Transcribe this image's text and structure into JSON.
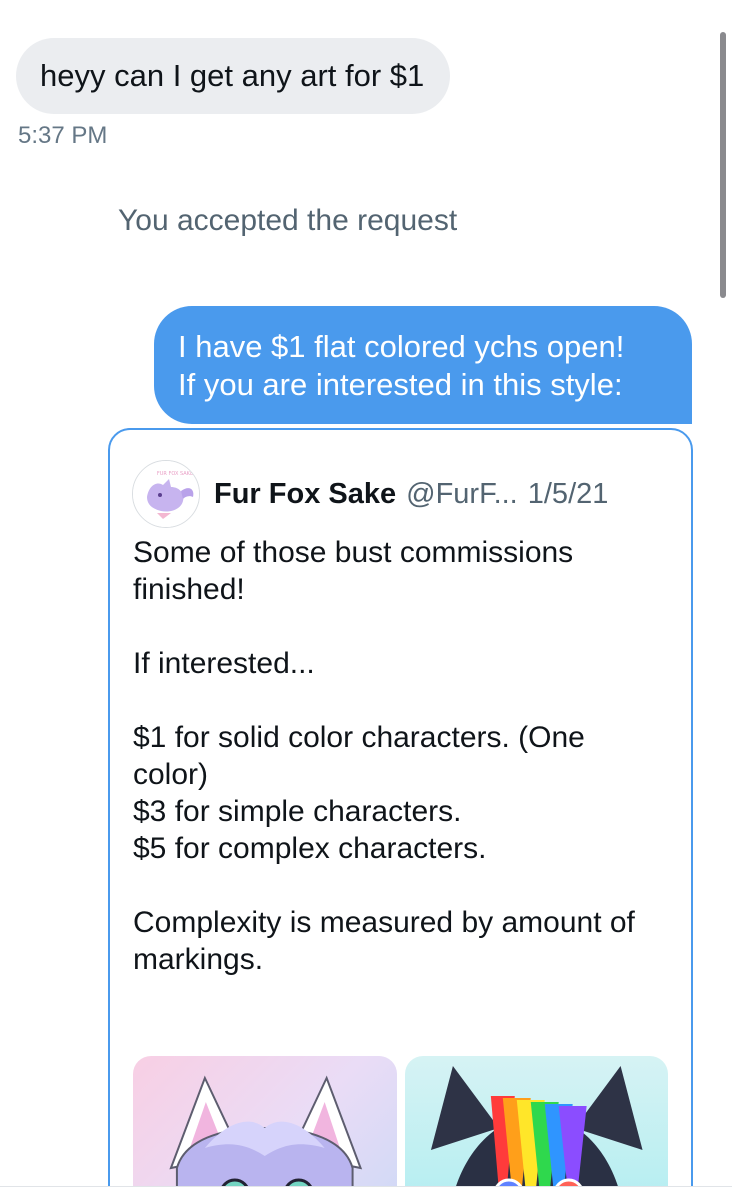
{
  "messages": {
    "incoming": {
      "text": "heyy can I get any art for $1",
      "time": "5:37 PM"
    },
    "system_note": "You accepted the request",
    "outgoing": {
      "line1": "I have $1 flat colored ychs open!",
      "line2": "If you are interested in this style:"
    }
  },
  "quoted_tweet": {
    "author_name": "Fur Fox Sake",
    "handle": "@FurF...",
    "date": "1/5/21",
    "avatar_text": "FUR FOX SAKE",
    "paragraphs": [
      "Some of those bust commissions finished!",
      "If interested...",
      "$1 for solid color characters. (One color)",
      "$3 for simple characters.",
      "$5 for complex characters.",
      "Complexity is measured by amount of markings."
    ],
    "media": [
      {
        "label": "left-fox-bust"
      },
      {
        "label": "right-rainbow-bust"
      }
    ]
  },
  "colors": {
    "incoming_bubble": "#ebedf0",
    "outgoing_bubble": "#4a9aed",
    "accent": "#4a9aed",
    "secondary_text": "#536471"
  },
  "icons": {
    "avatar": "fox-avatar-icon"
  }
}
